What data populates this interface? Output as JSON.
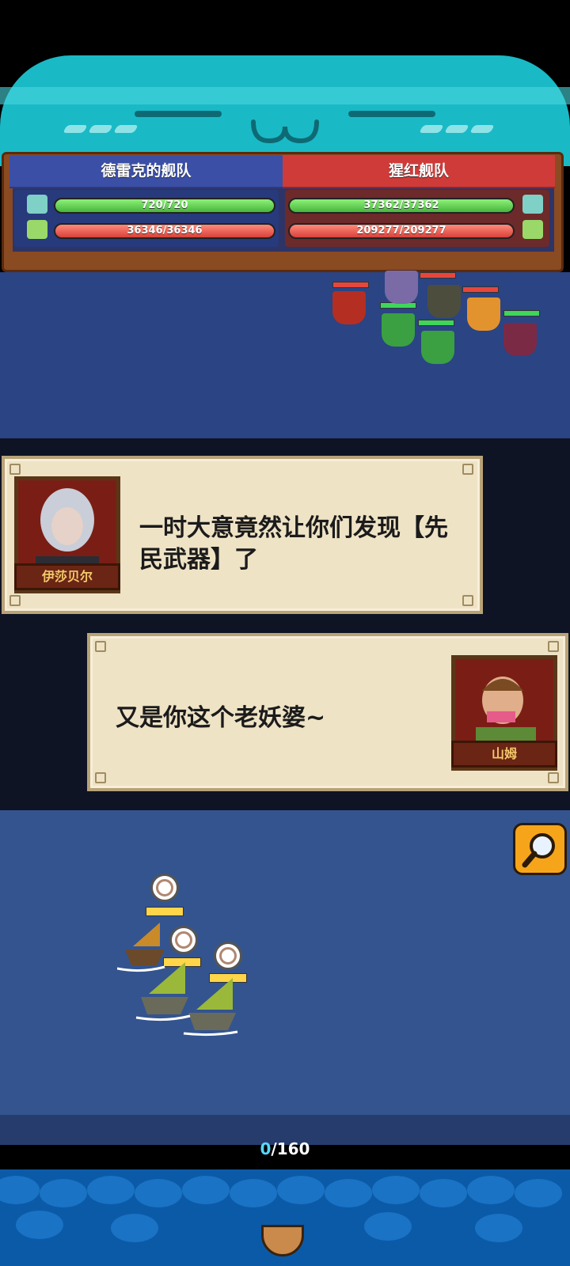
{
  "fleets": {
    "left": {
      "name": "德雷克的舰队",
      "crew": "720/720",
      "ships": "36346/36346",
      "color": "#3b4fa6"
    },
    "right": {
      "name": "猩红舰队",
      "crew": "37362/37362",
      "ships": "209277/209277",
      "color": "#cf3b38"
    }
  },
  "dialogue": [
    {
      "speaker": "伊莎贝尔",
      "text_line1": "一时大意竟然让你们发现【先",
      "text_line2": "民武器】了"
    },
    {
      "speaker": "山姆",
      "text_line1": "又是你这个老妖婆~"
    }
  ],
  "progress": {
    "current": "0",
    "total": "/160"
  },
  "icons": {
    "crew_icon": "sailor-icon",
    "ship_icon": "ship-icon",
    "search": "magnifier-icon"
  }
}
